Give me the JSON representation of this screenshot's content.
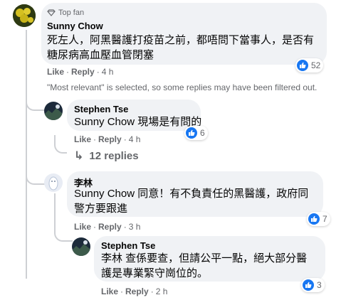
{
  "comments": [
    {
      "badge": "Top fan",
      "author": "Sunny Chow",
      "text_line1": "死左人，阿黑醫護打疫苗之前，都唔問下當事人，是否有",
      "text_line2": "糖尿病高血壓血管閉塞",
      "like_label": "Like",
      "reply_label": "Reply",
      "time": "4 h",
      "reactions": "52"
    }
  ],
  "filter_notice": "\"Most relevant\" is selected, so some replies may have been filtered out.",
  "reply1": {
    "author": "Stephen Tse",
    "tag": "Sunny Chow",
    "text": " 現場是有問的",
    "like_label": "Like",
    "reply_label": "Reply",
    "time": "4 h",
    "reactions": "6"
  },
  "view_replies": "12 replies",
  "reply2": {
    "author": "李林",
    "tag": "Sunny Chow",
    "text_line1": " 同意！有不負責任的黑醫護，政府同",
    "text_line2": "警方要跟進",
    "like_label": "Like",
    "reply_label": "Reply",
    "time": "3 h",
    "reactions": "7"
  },
  "reply3": {
    "author": "Stephen Tse",
    "tag": "李林",
    "text_line1": " 查係要查，但請公平一點，絕大部分醫",
    "text_line2": "護是專業緊守崗位的。",
    "like_label": "Like",
    "reply_label": "Reply",
    "time": "2 h",
    "reactions": "3"
  },
  "colors": {
    "bubble": "#f0f2f5",
    "like_blue": "#1877f2",
    "meta_gray": "#65676b"
  }
}
